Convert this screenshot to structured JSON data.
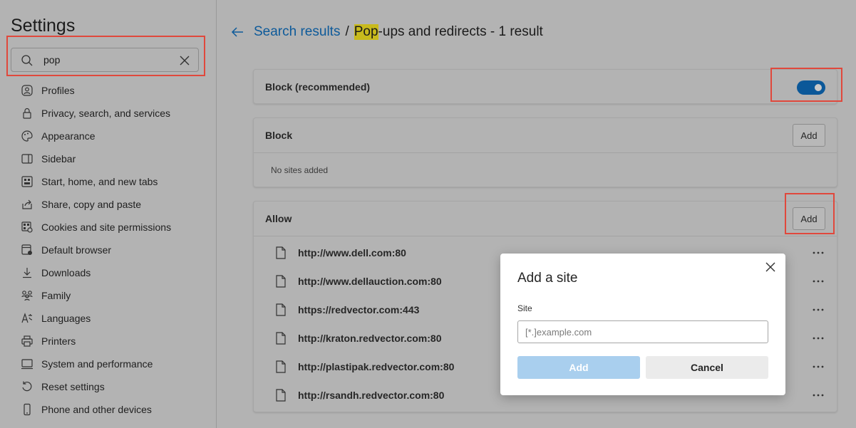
{
  "app": {
    "title": "Settings"
  },
  "search": {
    "value": "pop",
    "icon": "search-icon",
    "clear_icon": "close-icon"
  },
  "sidebar": {
    "items": [
      {
        "label": "Profiles",
        "icon": "profile-icon"
      },
      {
        "label": "Privacy, search, and services",
        "icon": "lock-icon"
      },
      {
        "label": "Appearance",
        "icon": "palette-icon"
      },
      {
        "label": "Sidebar",
        "icon": "sidebar-icon"
      },
      {
        "label": "Start, home, and new tabs",
        "icon": "home-tabs-icon"
      },
      {
        "label": "Share, copy and paste",
        "icon": "share-icon"
      },
      {
        "label": "Cookies and site permissions",
        "icon": "cookies-icon"
      },
      {
        "label": "Default browser",
        "icon": "browser-icon"
      },
      {
        "label": "Downloads",
        "icon": "download-icon"
      },
      {
        "label": "Family",
        "icon": "family-icon"
      },
      {
        "label": "Languages",
        "icon": "languages-icon"
      },
      {
        "label": "Printers",
        "icon": "printer-icon"
      },
      {
        "label": "System and performance",
        "icon": "system-icon"
      },
      {
        "label": "Reset settings",
        "icon": "reset-icon"
      },
      {
        "label": "Phone and other devices",
        "icon": "phone-icon"
      }
    ]
  },
  "breadcrumb": {
    "back_icon": "back-arrow-icon",
    "link": "Search results",
    "separator": "/",
    "highlight": "Pop",
    "rest": "-ups and redirects - 1 result"
  },
  "block_recommended": {
    "label": "Block (recommended)",
    "enabled": true
  },
  "block_section": {
    "title": "Block",
    "add_label": "Add",
    "empty_text": "No sites added"
  },
  "allow_section": {
    "title": "Allow",
    "add_label": "Add",
    "sites": [
      "http://www.dell.com:80",
      "http://www.dellauction.com:80",
      "https://redvector.com:443",
      "http://kraton.redvector.com:80",
      "http://plastipak.redvector.com:80",
      "http://rsandh.redvector.com:80"
    ]
  },
  "dialog": {
    "title": "Add a site",
    "field_label": "Site",
    "placeholder": "[*.]example.com",
    "add_label": "Add",
    "cancel_label": "Cancel"
  },
  "colors": {
    "accent": "#0b5899",
    "link": "#0d5a9a",
    "highlight_box": "#e0483c",
    "search_highlight": "#c8ba1c"
  }
}
